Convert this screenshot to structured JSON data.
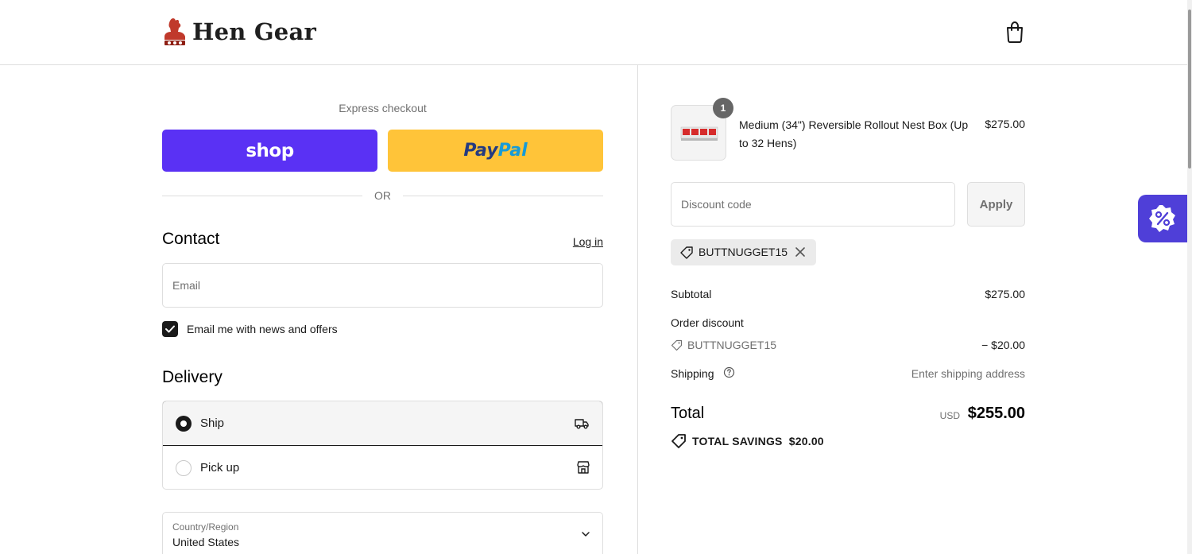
{
  "header": {
    "brand_name": "Hen Gear"
  },
  "express": {
    "label": "Express checkout",
    "shop_label": "shop",
    "paypal_part1": "Pay",
    "paypal_part2": "Pal",
    "or_label": "OR"
  },
  "contact": {
    "heading": "Contact",
    "login_label": "Log in",
    "email_placeholder": "Email",
    "email_value": "",
    "newsletter_label": "Email me with news and offers",
    "newsletter_checked": true
  },
  "delivery": {
    "heading": "Delivery",
    "options": [
      {
        "label": "Ship",
        "selected": true,
        "icon": "truck-icon"
      },
      {
        "label": "Pick up",
        "selected": false,
        "icon": "store-icon"
      }
    ],
    "country_label": "Country/Region",
    "country_value": "United States"
  },
  "order": {
    "product_name": "Medium (34\") Reversible Rollout Nest Box (Up to 32 Hens)",
    "product_price": "$275.00",
    "quantity": "1",
    "discount_placeholder": "Discount code",
    "discount_value": "",
    "apply_label": "Apply",
    "applied_code": "BUTTNUGGET15",
    "subtotal_label": "Subtotal",
    "subtotal_value": "$275.00",
    "order_discount_label": "Order discount",
    "order_discount_code": "BUTTNUGGET15",
    "order_discount_value": "− $20.00",
    "shipping_label": "Shipping",
    "shipping_value": "Enter shipping address",
    "total_label": "Total",
    "total_currency": "USD",
    "total_value": "$255.00",
    "savings_label": "TOTAL SAVINGS",
    "savings_value": "$20.00"
  },
  "colors": {
    "shop_pay": "#5a31f4",
    "paypal": "#ffc439",
    "promo_tab": "#4f3fd8",
    "brand_red": "#c0392b"
  }
}
